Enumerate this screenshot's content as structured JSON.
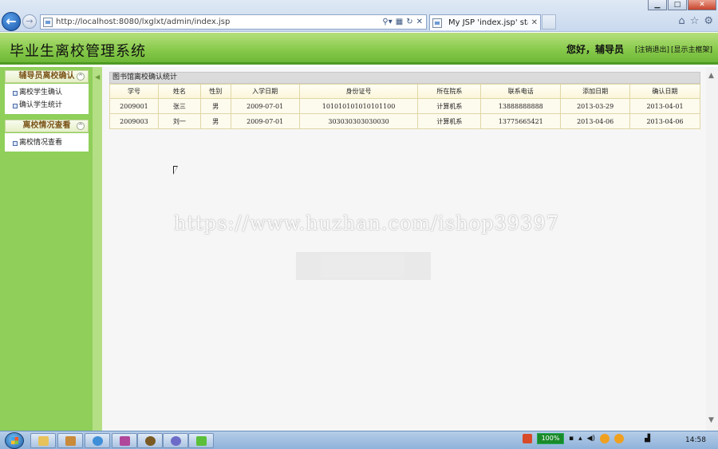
{
  "browser": {
    "address": "http://localhost:8080/lxglxt/admin/index.jsp",
    "tab_title": "My JSP 'index.jsp' startin...",
    "window_controls": [
      "minimize",
      "maximize",
      "close"
    ]
  },
  "header": {
    "title": "毕业生离校管理系统",
    "greeting": "您好，辅导员",
    "logout_link": "[注销退出]",
    "home_link": "[显示主框架]"
  },
  "sidebar": {
    "sections": [
      {
        "title": "辅导员离校确认",
        "items": [
          "离校学生确认",
          "确认学生统计"
        ]
      },
      {
        "title": "离校情况查看",
        "items": [
          "离校情况查看"
        ]
      }
    ]
  },
  "panel": {
    "title": "图书馆离校确认统计",
    "columns": [
      "学号",
      "姓名",
      "性别",
      "入学日期",
      "身份证号",
      "所在院系",
      "联系电话",
      "添加日期",
      "确认日期"
    ],
    "rows": [
      [
        "2009001",
        "张三",
        "男",
        "2009-07-01",
        "101010101010101100",
        "计算机系",
        "13888888888",
        "2013-03-29",
        "2013-04-01"
      ],
      [
        "2009003",
        "刘一",
        "男",
        "2009-07-01",
        "303030303030030",
        "计算机系",
        "13775665421",
        "2013-04-06",
        "2013-04-06"
      ]
    ]
  },
  "watermark": "https://www.huzhan.com/ishop39397",
  "taskbar": {
    "battery": "100%",
    "clock": "14:58"
  },
  "colors": {
    "header_green": "#86c94a",
    "sidebar_green": "#8fcf5a",
    "menu_title": "#7a5418"
  }
}
